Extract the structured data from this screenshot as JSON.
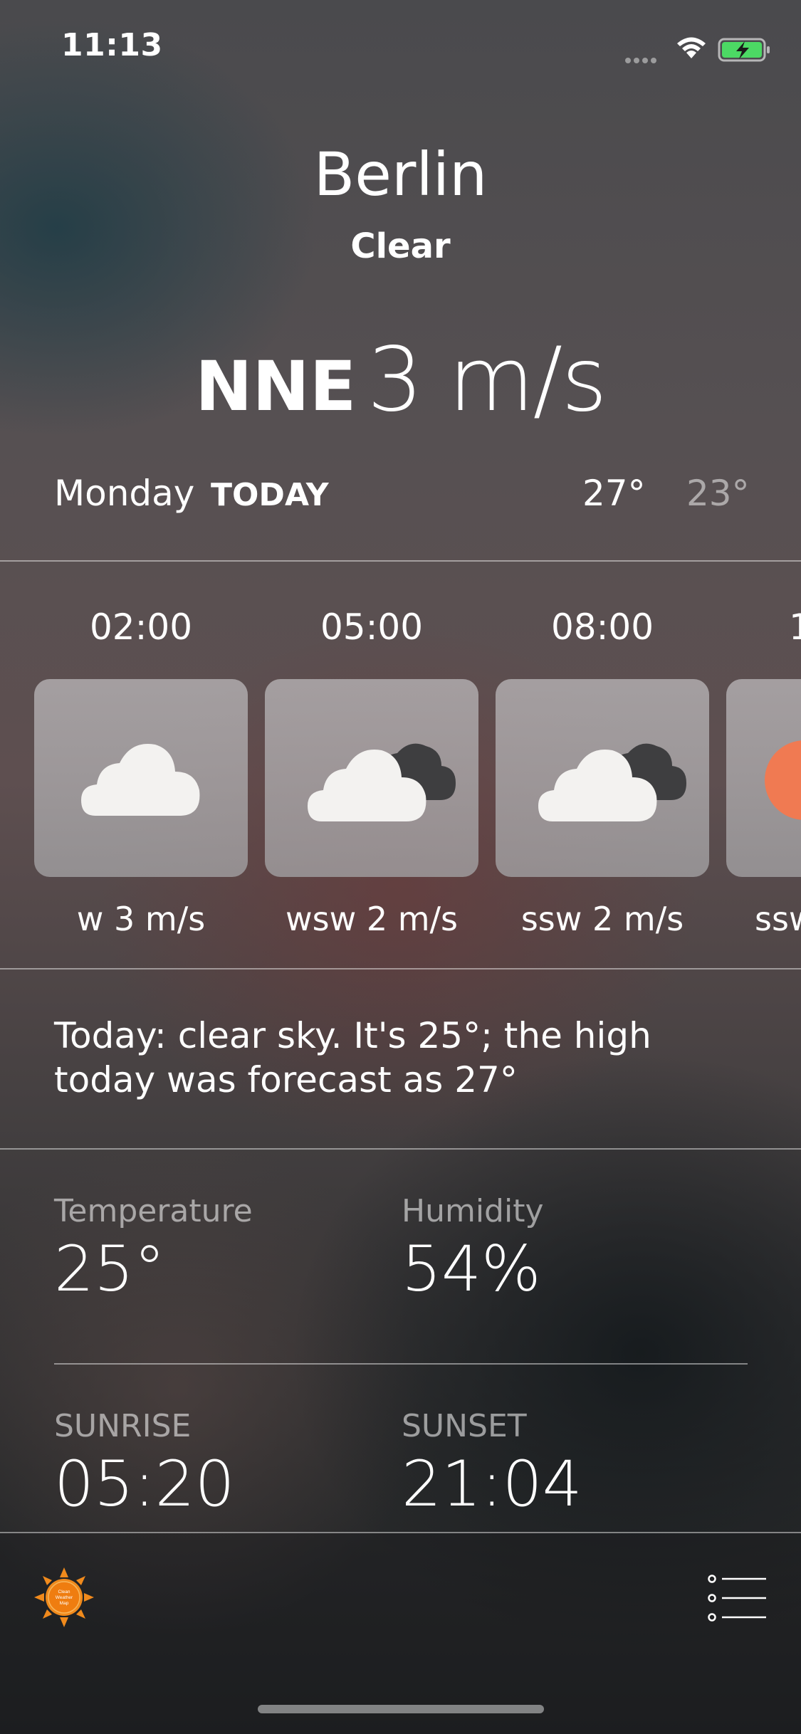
{
  "status_bar": {
    "time": "11:13"
  },
  "header": {
    "city": "Berlin",
    "condition": "Clear",
    "wind_direction": "NNE",
    "wind_speed": "3 m/s"
  },
  "today_row": {
    "day": "Monday",
    "today_label": "TODAY",
    "high": "27°",
    "low": "23°"
  },
  "hourly": [
    {
      "time": "02:00",
      "icon": "cloud-icon",
      "wind": "w 3 m/s"
    },
    {
      "time": "05:00",
      "icon": "cloud-dark-cloud-icon",
      "wind": "wsw 2 m/s"
    },
    {
      "time": "08:00",
      "icon": "cloud-dark-cloud-icon",
      "wind": "ssw 2 m/s"
    },
    {
      "time": "1",
      "icon": "sun-icon",
      "wind": "ssw"
    }
  ],
  "summary": "Today: clear sky. It's 25°; the high today was forecast as 27°",
  "details": {
    "temperature_label": "Temperature",
    "temperature_value": "25°",
    "humidity_label": "Humidity",
    "humidity_value": "54%",
    "sunrise_label": "SUNRISE",
    "sunrise_value": "05:20",
    "sunset_label": "SUNSET",
    "sunset_value": "21:04"
  },
  "tab_bar": {
    "logo_text": [
      "Clean",
      "Weather",
      "Map"
    ],
    "logo_icon": "sun-logo-icon",
    "menu_icon": "list-menu-icon"
  },
  "colors": {
    "logo_orange": "#f08a1c",
    "partial_sun": "#f07a52"
  }
}
